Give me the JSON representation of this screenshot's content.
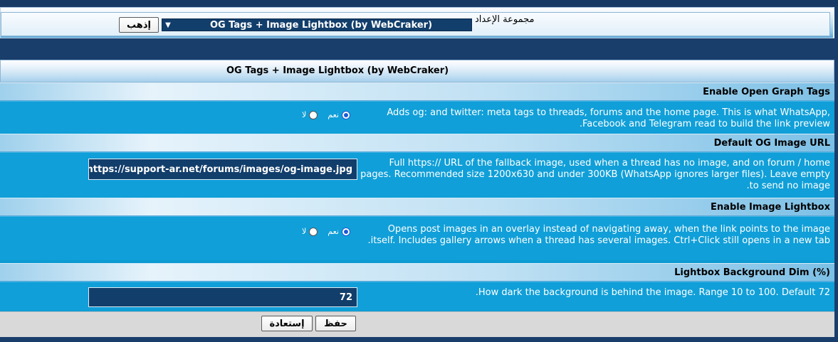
{
  "group": {
    "label": "مجموعة الإعداد",
    "selected": "OG Tags + Image Lightbox (by WebCraker)",
    "go_label": "إذهب"
  },
  "panel": {
    "title": "OG Tags + Image Lightbox (by WebCraker)"
  },
  "settings": [
    {
      "heading": "Enable Open Graph Tags",
      "description": "Adds og: and twitter: meta tags to threads, forums and the home page. This is what WhatsApp, Facebook and Telegram read to build the link preview.",
      "yes_label": "نعم",
      "no_label": "لا"
    },
    {
      "heading": "Default OG Image URL",
      "description": "Full https:// URL of the fallback image, used when a thread has no image, and on forum / home pages. Recommended size 1200x630 and under 300KB (WhatsApp ignores larger files). Leave empty to send no image.",
      "value": "https://support-ar.net/forums/images/og-image.jpg"
    },
    {
      "heading": "Enable Image Lightbox",
      "description": "Opens post images in an overlay instead of navigating away, when the link points to the image itself. Includes gallery arrows when a thread has several images. Ctrl+Click still opens in a new tab.",
      "yes_label": "نعم",
      "no_label": "لا"
    },
    {
      "heading": "Lightbox Background Dim (%)",
      "description": "How dark the background is behind the image. Range 10 to 100. Default 72.",
      "value": "72"
    }
  ],
  "footer": {
    "save_label": "حفظ",
    "reset_label": "إستعادة"
  }
}
